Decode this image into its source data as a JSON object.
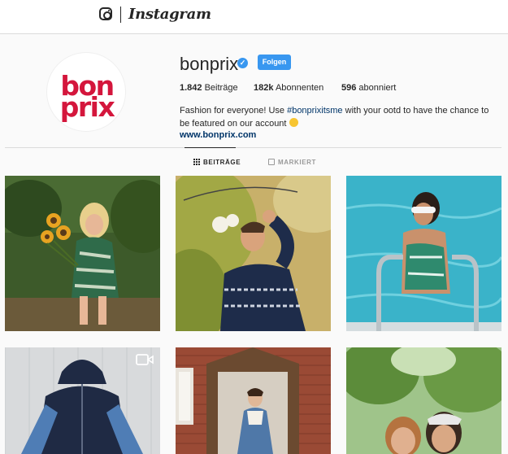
{
  "header": {
    "brand": "Instagram",
    "icon": "instagram-glyph-icon"
  },
  "profile": {
    "username": "bonprix",
    "verified_icon": "verified-badge-icon",
    "follow_label": "Folgen",
    "avatar_logo": [
      "bon",
      "prix"
    ],
    "stats": {
      "posts_value": "1.842",
      "posts_label": "Beiträge",
      "followers_value": "182k",
      "followers_label": "Abonnenten",
      "following_value": "596",
      "following_label": "abonniert"
    },
    "bio": {
      "text_before": "Fashion for everyone! Use ",
      "hashtag": "#bonprixitsme",
      "text_after": " with your ootd to have the chance to be featured on our account",
      "emoji": "grinning-emoji"
    },
    "website": "www.bonprix.com"
  },
  "tabs": [
    {
      "label": "BEITRÄGE",
      "icon": "grid-icon",
      "active": true
    },
    {
      "label": "MARKIERT",
      "icon": "tagged-icon",
      "active": false
    }
  ],
  "posts": [
    {
      "alt": "woman-with-sunflowers",
      "type": "image"
    },
    {
      "alt": "man-with-string-lights",
      "type": "image"
    },
    {
      "alt": "woman-at-pool-ladder",
      "type": "image"
    },
    {
      "alt": "rain-jacket",
      "type": "video"
    },
    {
      "alt": "woman-in-dirndl-at-door",
      "type": "image"
    },
    {
      "alt": "two-women-smiling",
      "type": "image"
    }
  ],
  "colors": {
    "accent": "#3897f0",
    "brand_red": "#d4163c",
    "link": "#003569"
  }
}
